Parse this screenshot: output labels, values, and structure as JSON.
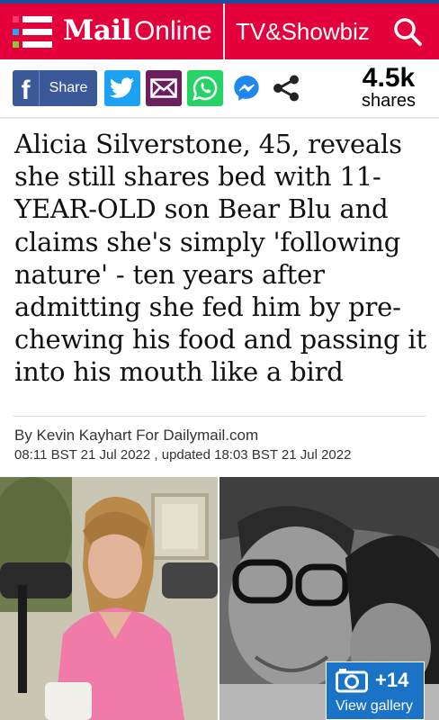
{
  "header": {
    "brand_bold": "Mail",
    "brand_light": "Online",
    "section": "TV&Showbiz",
    "brand_color": "#e4003a",
    "menu_squares": [
      "#e4003a",
      "#1e90ff",
      "#8cc63e",
      "#ff8a00",
      "#8b3fb8"
    ]
  },
  "share": {
    "facebook_label": "Share",
    "count": "4.5k",
    "count_label": "shares",
    "buttons": [
      "facebook-icon",
      "twitter-icon",
      "email-icon",
      "whatsapp-icon",
      "messenger-icon",
      "more-share-icon"
    ]
  },
  "article": {
    "headline": "Alicia Silverstone, 45, reveals she still shares bed with 11-YEAR-OLD son Bear Blu and claims she's simply 'following nature' - ten years after admitting she fed him by pre-chewing his food and passing it into his mouth like a bird",
    "byline": "By Kevin Kayhart For Dailymail.com",
    "dates": "08:11 BST 21 Jul 2022 , updated 18:03 BST 21 Jul 2022"
  },
  "gallery": {
    "count": "+14",
    "label": "View gallery",
    "color": "#1a73c6"
  }
}
